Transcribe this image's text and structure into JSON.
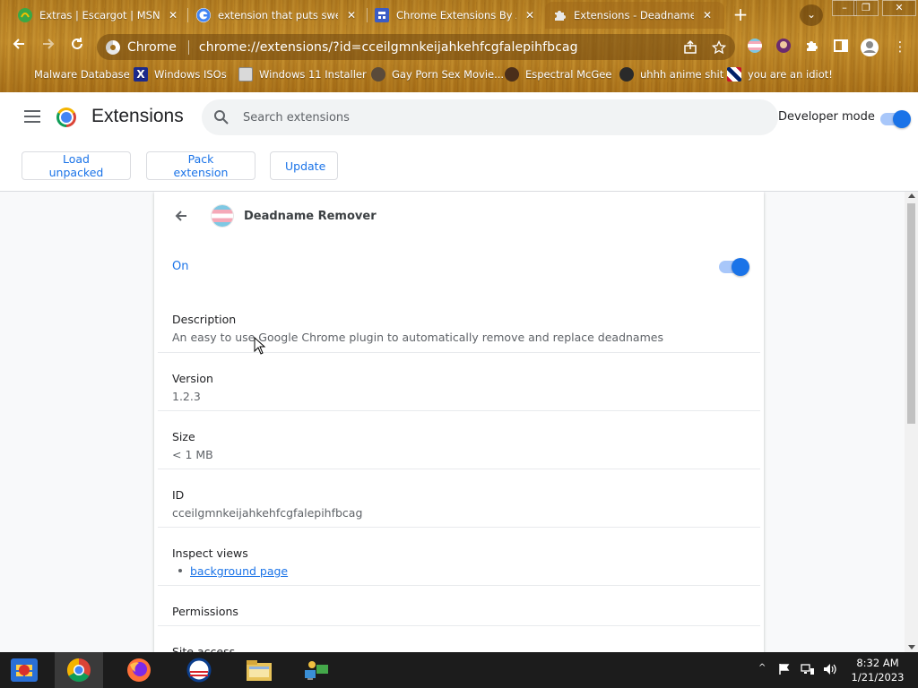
{
  "browser": {
    "tabs": [
      {
        "title": "Extras | Escargot | MSN",
        "icon": "escargot-icon",
        "color": "#3aa845"
      },
      {
        "title": "extension that puts swear",
        "icon": "google-icon",
        "color": "#4285f4"
      },
      {
        "title": "Chrome Extensions By An",
        "icon": "web-store-icon",
        "color": "#3b5cc4"
      },
      {
        "title": "Extensions - Deadname Re",
        "icon": "puzzle-icon",
        "color": "#e8e8e8",
        "active": true
      }
    ],
    "new_tab_symbol": "+",
    "tab_search_symbol": "⌄",
    "window_controls": [
      "–",
      "❐",
      "✕"
    ],
    "omnibox": {
      "site": "Chrome",
      "url": "chrome://extensions/?id=cceilgmnkeijahkehfcgfalepihfbcag"
    },
    "bookmarks": [
      {
        "label": "Malware Database",
        "icon": "bookmark-icon"
      },
      {
        "label": "Windows ISOs",
        "icon": "x-icon"
      },
      {
        "label": "Windows 11 Installer",
        "icon": "image-icon"
      },
      {
        "label": "Gay Porn Sex Movie...",
        "icon": "tank-icon"
      },
      {
        "label": "Espectral McGee",
        "icon": "avatar-icon"
      },
      {
        "label": "uhhh anime shit",
        "icon": "anime-icon"
      },
      {
        "label": "you are an idiot!",
        "icon": "flag-icon"
      }
    ]
  },
  "header": {
    "title": "Extensions",
    "search_placeholder": "Search extensions",
    "developer_mode_label": "Developer mode",
    "developer_mode_on": true,
    "buttons": {
      "load_unpacked": "Load unpacked",
      "pack_extension": "Pack extension",
      "update": "Update"
    }
  },
  "detail": {
    "name": "Deadname Remover",
    "state_label": "On",
    "enabled": true,
    "description_label": "Description",
    "description": "An easy to use Google Chrome plugin to automatically remove and replace deadnames",
    "version_label": "Version",
    "version": "1.2.3",
    "size_label": "Size",
    "size": "< 1 MB",
    "id_label": "ID",
    "id": "cceilgmnkeijahkehfcgfalepihfbcag",
    "inspect_label": "Inspect views",
    "inspect_link": "background page",
    "permissions_label": "Permissions",
    "site_access_label": "Site access"
  },
  "taskbar": {
    "apps": [
      "start-icon",
      "chrome-icon",
      "firefox-icon",
      "obama-icon",
      "file-explorer-icon",
      "network-icon"
    ],
    "time": "8:32 AM",
    "date": "1/21/2023"
  },
  "colors": {
    "accent": "#1a73e8",
    "chrome_theme": "#b07a1e"
  }
}
